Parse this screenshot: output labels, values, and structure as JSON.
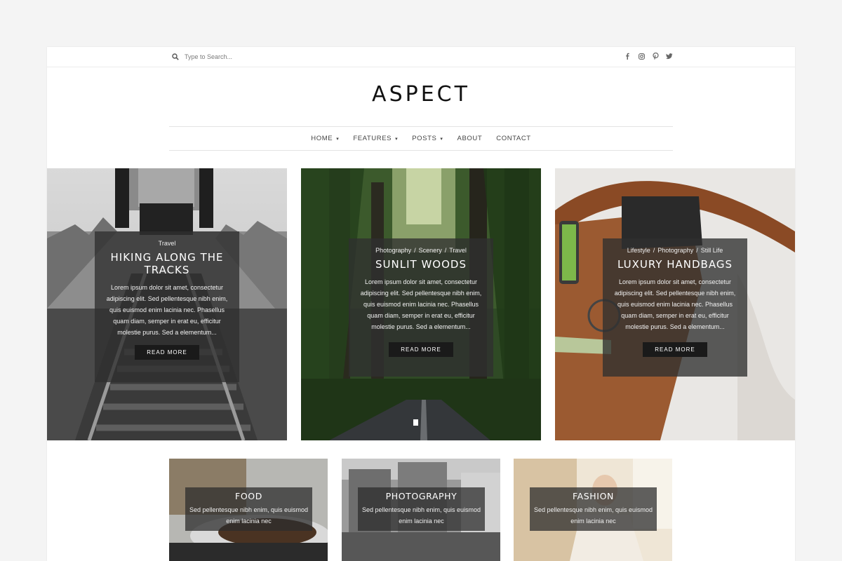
{
  "site": {
    "logo": "ASPECT"
  },
  "search": {
    "placeholder": "Type to Search..."
  },
  "social": [
    "facebook-icon",
    "instagram-icon",
    "pinterest-icon",
    "twitter-icon"
  ],
  "nav": [
    {
      "label": "HOME",
      "dropdown": true
    },
    {
      "label": "FEATURES",
      "dropdown": true
    },
    {
      "label": "POSTS",
      "dropdown": true
    },
    {
      "label": "ABOUT",
      "dropdown": false
    },
    {
      "label": "CONTACT",
      "dropdown": false
    }
  ],
  "featured": [
    {
      "categories": [
        "Travel"
      ],
      "title": "HIKING ALONG THE TRACKS",
      "excerpt": "Lorem ipsum dolor sit amet, consectetur adipiscing elit. Sed pellentesque nibh enim, quis euismod enim lacinia nec. Phasellus quam diam, semper in erat eu, efficitur molestie purus. Sed a elementum...",
      "button": "READ MORE"
    },
    {
      "categories": [
        "Photography",
        "Scenery",
        "Travel"
      ],
      "title": "SUNLIT WOODS",
      "excerpt": "Lorem ipsum dolor sit amet, consectetur adipiscing elit. Sed pellentesque nibh enim, quis euismod enim lacinia nec. Phasellus quam diam, semper in erat eu, efficitur molestie purus. Sed a elementum...",
      "button": "READ MORE"
    },
    {
      "categories": [
        "Lifestyle",
        "Photography",
        "Still Life"
      ],
      "title": "LUXURY HANDBAGS",
      "excerpt": "Lorem ipsum dolor sit amet, consectetur adipiscing elit. Sed pellentesque nibh enim, quis euismod enim lacinia nec. Phasellus quam diam, semper in erat eu, efficitur molestie purus. Sed a elementum...",
      "button": "READ MORE"
    }
  ],
  "category_tiles": [
    {
      "title": "FOOD",
      "text": "Sed pellentesque nibh enim, quis euismod enim lacinia nec"
    },
    {
      "title": "PHOTOGRAPHY",
      "text": "Sed pellentesque nibh enim, quis euismod enim lacinia nec"
    },
    {
      "title": "FASHION",
      "text": "Sed pellentesque nibh enim, quis euismod enim lacinia nec"
    }
  ]
}
